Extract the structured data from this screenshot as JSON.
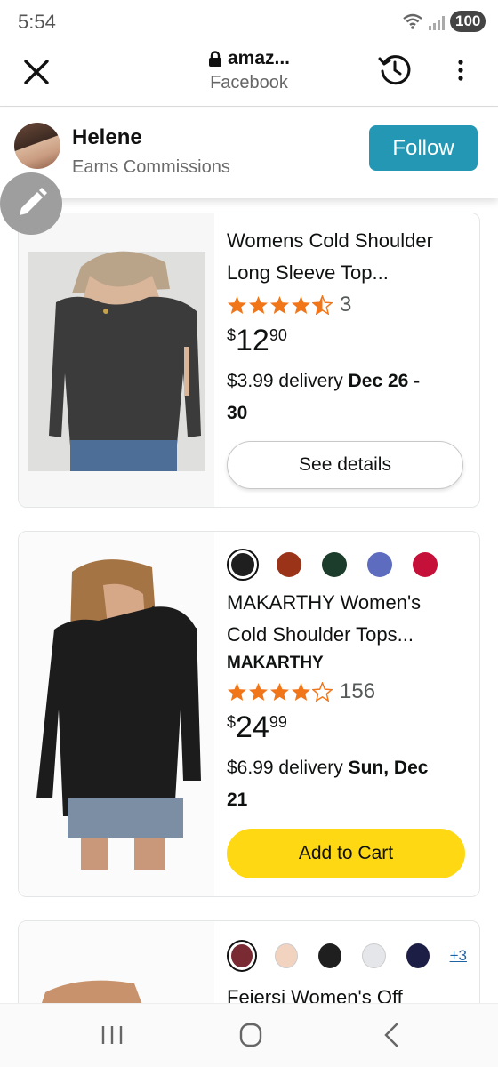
{
  "status": {
    "time": "5:54",
    "battery": "100",
    "wifi_badge": "5"
  },
  "browser": {
    "domain": "amaz...",
    "subtitle": "Facebook"
  },
  "creator": {
    "name": "Helene",
    "role": "Earns Commissions",
    "follow_label": "Follow"
  },
  "products": [
    {
      "title_line1": "Womens Cold Shoulder",
      "title_line2": "Long Sleeve Top...",
      "rating": 4.5,
      "review_count": "3",
      "price_currency": "$",
      "price_whole": "12",
      "price_fraction": "90",
      "delivery_prefix": "$3.99 delivery ",
      "delivery_date_line1": "Dec 26 -",
      "delivery_date_line2": "30",
      "button_label": "See details"
    },
    {
      "swatches": [
        "#1f1f1f",
        "#9a3318",
        "#1d3d2c",
        "#5e6cc0",
        "#c5113a"
      ],
      "title_line1": "MAKARTHY Women's",
      "title_line2": "Cold Shoulder Tops...",
      "brand": "MAKARTHY",
      "rating": 4.0,
      "review_count": "156",
      "price_currency": "$",
      "price_whole": "24",
      "price_fraction": "99",
      "delivery_prefix": "$6.99 delivery ",
      "delivery_date_line1": "Sun, Dec",
      "delivery_date_line2": "21",
      "button_label": "Add to Cart"
    },
    {
      "swatches": [
        "#7a2a33",
        "#f2d3c0",
        "#1f1f1f",
        "#e4e6ea",
        "#1c1e45"
      ],
      "more_colors": "+3",
      "title_line1": "Feiersi Women's Off"
    }
  ],
  "colors": {
    "follow": "#2397b3",
    "star": "#f1761a",
    "add_to_cart": "#ffd814",
    "link": "#2162a1"
  }
}
